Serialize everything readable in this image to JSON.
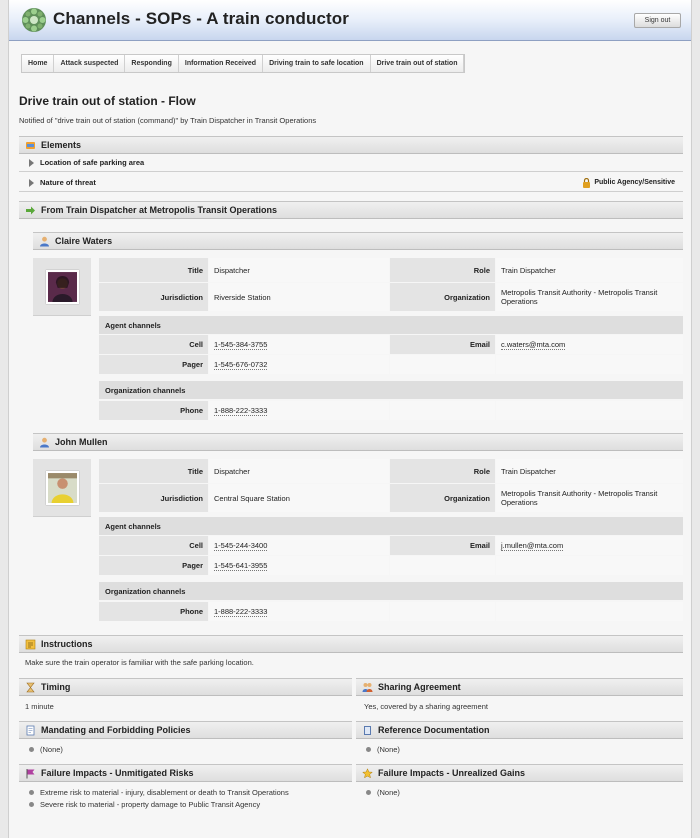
{
  "app": {
    "title": "Channels - SOPs - A train conductor",
    "signout": "Sign out"
  },
  "breadcrumbs": [
    "Home",
    "Attack suspected",
    "Responding",
    "Information Received",
    "Driving train to safe location",
    "Drive train out of station"
  ],
  "page": {
    "title": "Drive train out of station - Flow",
    "subtitle": "Notified of \"drive train out of station (command)\" by Train Dispatcher in Transit Operations"
  },
  "elements": {
    "header": "Elements",
    "items": [
      "Location of safe parking area",
      "Nature of threat"
    ],
    "sensitivity": "Public Agency/Sensitive"
  },
  "from": {
    "header": "From Train Dispatcher at Metropolis Transit Operations"
  },
  "contacts": [
    {
      "name": "Claire Waters",
      "labels": {
        "title": "Title",
        "role": "Role",
        "jurisdiction": "Jurisdiction",
        "organization": "Organization",
        "cell": "Cell",
        "email": "Email",
        "pager": "Pager",
        "phone": "Phone"
      },
      "title": "Dispatcher",
      "role": "Train Dispatcher",
      "jurisdiction": "Riverside Station",
      "organization": "Metropolis Transit Authority - Metropolis Transit Operations",
      "agent_channels": "Agent channels",
      "cell": "1-545-384-3755",
      "email": "c.waters@mta.com",
      "pager": "1-545-676-0732",
      "org_channels": "Organization channels",
      "phone": "1-888-222-3333"
    },
    {
      "name": "John Mullen",
      "labels": {
        "title": "Title",
        "role": "Role",
        "jurisdiction": "Jurisdiction",
        "organization": "Organization",
        "cell": "Cell",
        "email": "Email",
        "pager": "Pager",
        "phone": "Phone"
      },
      "title": "Dispatcher",
      "role": "Train Dispatcher",
      "jurisdiction": "Central Square Station",
      "organization": "Metropolis Transit Authority - Metropolis Transit Operations",
      "agent_channels": "Agent channels",
      "cell": "1-545-244-3400",
      "email": "j.mullen@mta.com",
      "pager": "1-545-641-3955",
      "org_channels": "Organization channels",
      "phone": "1-888-222-3333"
    }
  ],
  "instructions": {
    "header": "Instructions",
    "text": "Make sure the train operator is familiar with the safe parking location."
  },
  "timing": {
    "header": "Timing",
    "text": "1 minute"
  },
  "sharing": {
    "header": "Sharing Agreement",
    "text": "Yes, covered by a sharing agreement"
  },
  "policies": {
    "header": "Mandating and Forbidding Policies",
    "items": [
      "(None)"
    ]
  },
  "reference": {
    "header": "Reference Documentation",
    "items": [
      "(None)"
    ]
  },
  "risks": {
    "header": "Failure Impacts - Unmitigated Risks",
    "items": [
      "Extreme risk to material - injury, disablement or death to Transit Operations",
      "Severe risk to material - property damage to Public Transit Agency"
    ]
  },
  "gains": {
    "header": "Failure Impacts - Unrealized Gains",
    "items": [
      "(None)"
    ]
  }
}
